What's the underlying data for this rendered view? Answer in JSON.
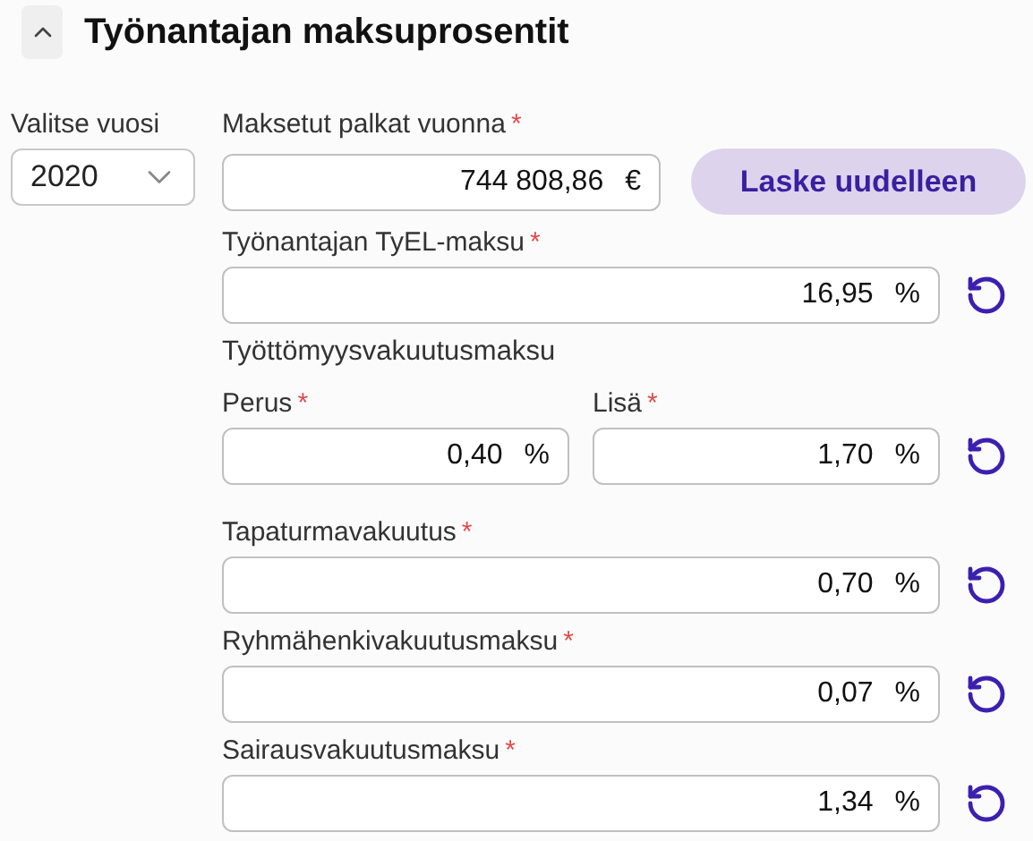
{
  "section": {
    "title": "Työnantajan maksuprosentit",
    "expanded": true
  },
  "year": {
    "label": "Valitse vuosi",
    "value": "2020"
  },
  "salary": {
    "label": "Maksetut palkat vuonna",
    "marker": "*",
    "value": "744 808,86",
    "unit": "€"
  },
  "recalc_button": {
    "label": "Laske uudelleen"
  },
  "rates": [
    {
      "kind": "single",
      "label": "Työnantajan TyEL-maksu",
      "marker": "*",
      "value": "16,95",
      "unit": "%"
    },
    {
      "kind": "group",
      "title": "Työttömyysvakuutusmaksu",
      "parts": [
        {
          "label": "Perus",
          "marker": "*",
          "value": "0,40",
          "unit": "%"
        },
        {
          "label": "Lisä",
          "marker": "*",
          "value": "1,70",
          "unit": "%"
        }
      ]
    },
    {
      "kind": "single",
      "label": "Tapaturmavakuutus",
      "marker": "*",
      "value": "0,70",
      "unit": "%"
    },
    {
      "kind": "single",
      "label": "Ryhmähenkivakuutusmaksu",
      "marker": "*",
      "value": "0,07",
      "unit": "%"
    },
    {
      "kind": "single",
      "label": "Sairausvakuutusmaksu",
      "marker": "*",
      "value": "1,34",
      "unit": "%"
    }
  ]
}
